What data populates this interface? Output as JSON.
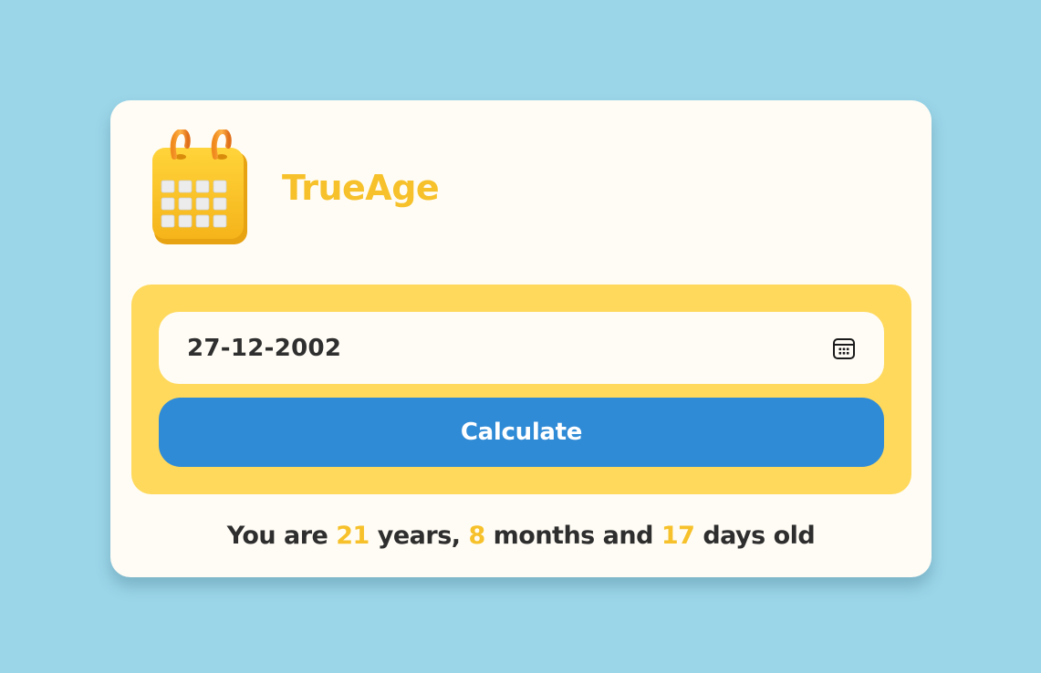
{
  "app": {
    "title": "TrueAge",
    "logo_icon": "calendar-icon"
  },
  "form": {
    "date_value": "27-12-2002",
    "date_icon": "calendar-picker-icon",
    "calculate_label": "Calculate"
  },
  "result": {
    "prefix": "You are",
    "years": "21",
    "years_label": "years,",
    "months": "8",
    "months_label": "months and",
    "days": "17",
    "days_label": "days old"
  },
  "colors": {
    "background": "#9bd5e8",
    "card": "#fffcf5",
    "panel": "#ffd95c",
    "accent": "#f6c12a",
    "button": "#308bd6",
    "text": "#2e2e2e"
  }
}
